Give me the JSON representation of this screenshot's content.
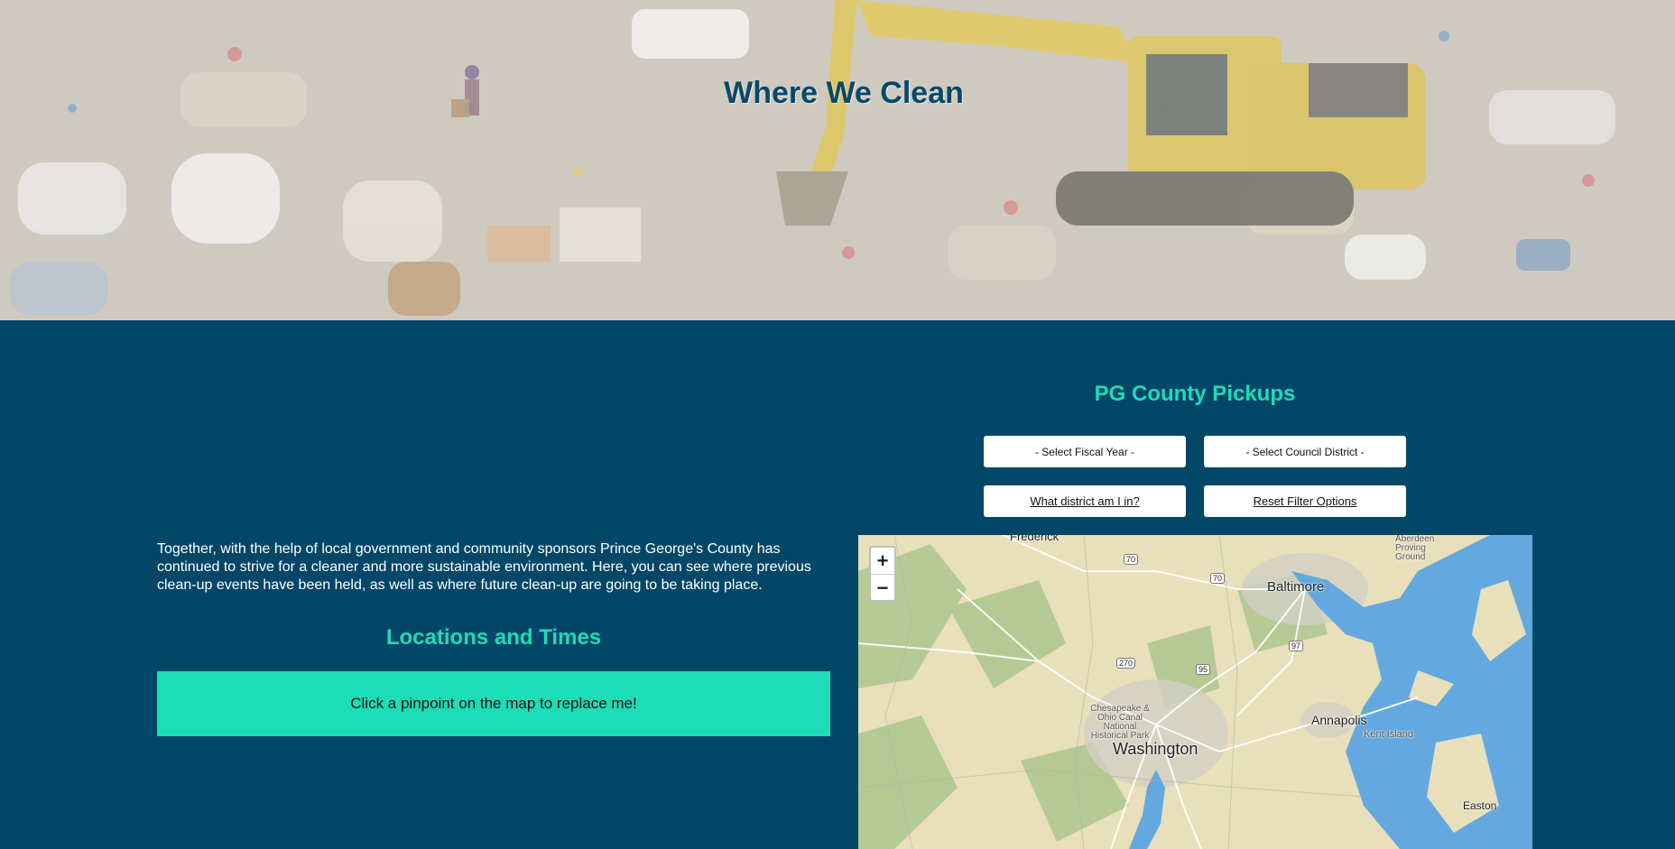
{
  "hero": {
    "title": "Where We Clean"
  },
  "intro": {
    "text": "Together, with the help of local government and community sponsors Prince George's County has continued to strive for a cleaner and more sustainable environment. Here, you can see where previous clean-up events have been held, as well as where future clean-up are going to be taking place."
  },
  "locations": {
    "title": "Locations and Times",
    "placeholder": "Click a pinpoint on the map to replace me!"
  },
  "pickups": {
    "title": "PG County Pickups",
    "fiscal_year_select": "- Select Fiscal Year -",
    "council_district_select": "- Select Council District -",
    "district_button": "What district am I in?",
    "reset_button": "Reset Filter Options"
  },
  "map": {
    "zoom_in": "+",
    "zoom_out": "−",
    "labels": {
      "frederick": "Frederick",
      "baltimore": "Baltimore",
      "aberdeen": "Aberdeen Proving Ground",
      "annapolis": "Annapolis",
      "kent_island": "Kent Island",
      "washington": "Washington",
      "chesapeake": "Chesapeake & Ohio Canal National Historical Park",
      "easton": "Easton",
      "i70": "70",
      "i70b": "70",
      "i270": "270",
      "i95": "95",
      "i97": "97"
    }
  },
  "colors": {
    "background": "#034768",
    "accent": "#1ddcb8",
    "water": "#63a9df"
  }
}
